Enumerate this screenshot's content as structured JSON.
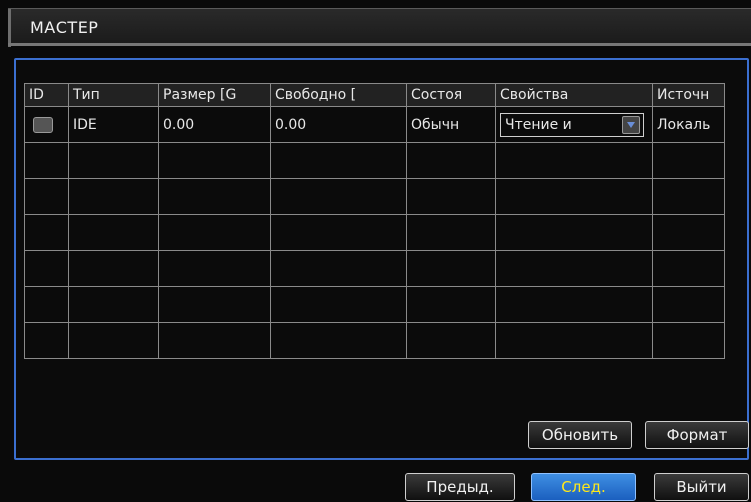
{
  "window": {
    "title": "МАСТЕР"
  },
  "table": {
    "columns": [
      "ID",
      "Тип",
      "Размер [G",
      "Свободно [",
      "Состоя",
      "Свойства",
      "Источн"
    ],
    "rows": [
      {
        "id": "",
        "type": "IDE",
        "size": "0.00",
        "free": "0.00",
        "state": "Обычн",
        "property": "Чтение и",
        "source": "Локаль"
      }
    ],
    "empty_rows": 6
  },
  "buttons": {
    "refresh": "Обновить",
    "format": "Формат",
    "prev": "Предыд.",
    "next": "След.",
    "exit": "Выйти"
  },
  "colors": {
    "accent_border": "#3b6fd0",
    "active_button": "#2a74d2",
    "active_text": "#ffe81a"
  }
}
